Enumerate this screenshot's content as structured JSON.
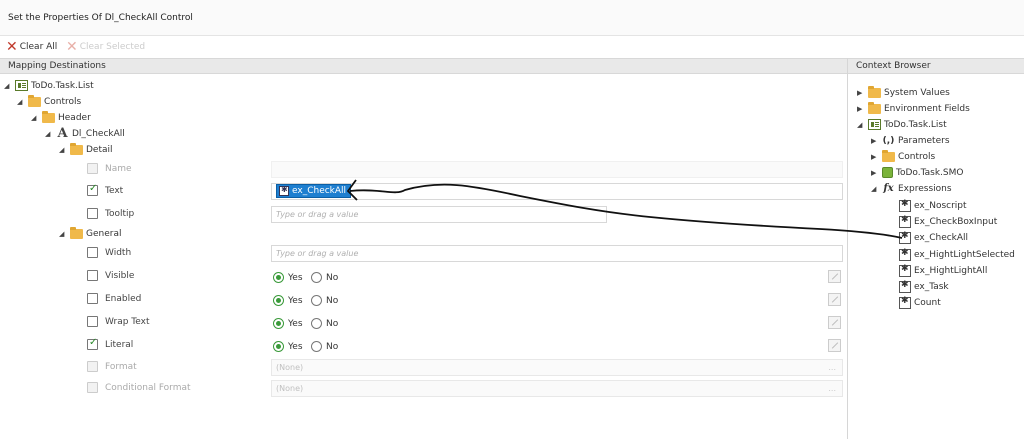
{
  "title": "Set the Properties Of Dl_CheckAll Control",
  "toolbar": {
    "clear_all": "Clear All",
    "clear_selected": "Clear Selected"
  },
  "panels": {
    "mapping": "Mapping Destinations",
    "context": "Context Browser"
  },
  "tree": {
    "root": "ToDo.Task.List",
    "controls": "Controls",
    "header": "Header",
    "control": "Dl_CheckAll",
    "detail": "Detail",
    "general": "General"
  },
  "properties": {
    "name": "Name",
    "text": "Text",
    "tooltip": "Tooltip",
    "width": "Width",
    "visible": "Visible",
    "enabled": "Enabled",
    "wrap_text": "Wrap Text",
    "literal": "Literal",
    "format": "Format",
    "conditional_format": "Conditional Format"
  },
  "values": {
    "text_token": "ex_CheckAll",
    "placeholder": "Type or drag a value",
    "none": "(None)",
    "yes": "Yes",
    "no": "No",
    "dots": "..."
  },
  "context": {
    "system_values": "System Values",
    "environment_fields": "Environment Fields",
    "list": "ToDo.Task.List",
    "parameters": "Parameters",
    "controls": "Controls",
    "smo": "ToDo.Task.SMO",
    "expressions": "Expressions",
    "expr_items": [
      "ex_Noscript",
      "Ex_CheckBoxInput",
      "ex_CheckAll",
      "ex_HightLightSelected",
      "Ex_HightLightAll",
      "ex_Task",
      "Count"
    ]
  },
  "colors": {
    "accent": "#1e7fd0",
    "folder": "#f0b94a",
    "clear_red": "#c0392b",
    "check_green": "#3a9a3a"
  }
}
